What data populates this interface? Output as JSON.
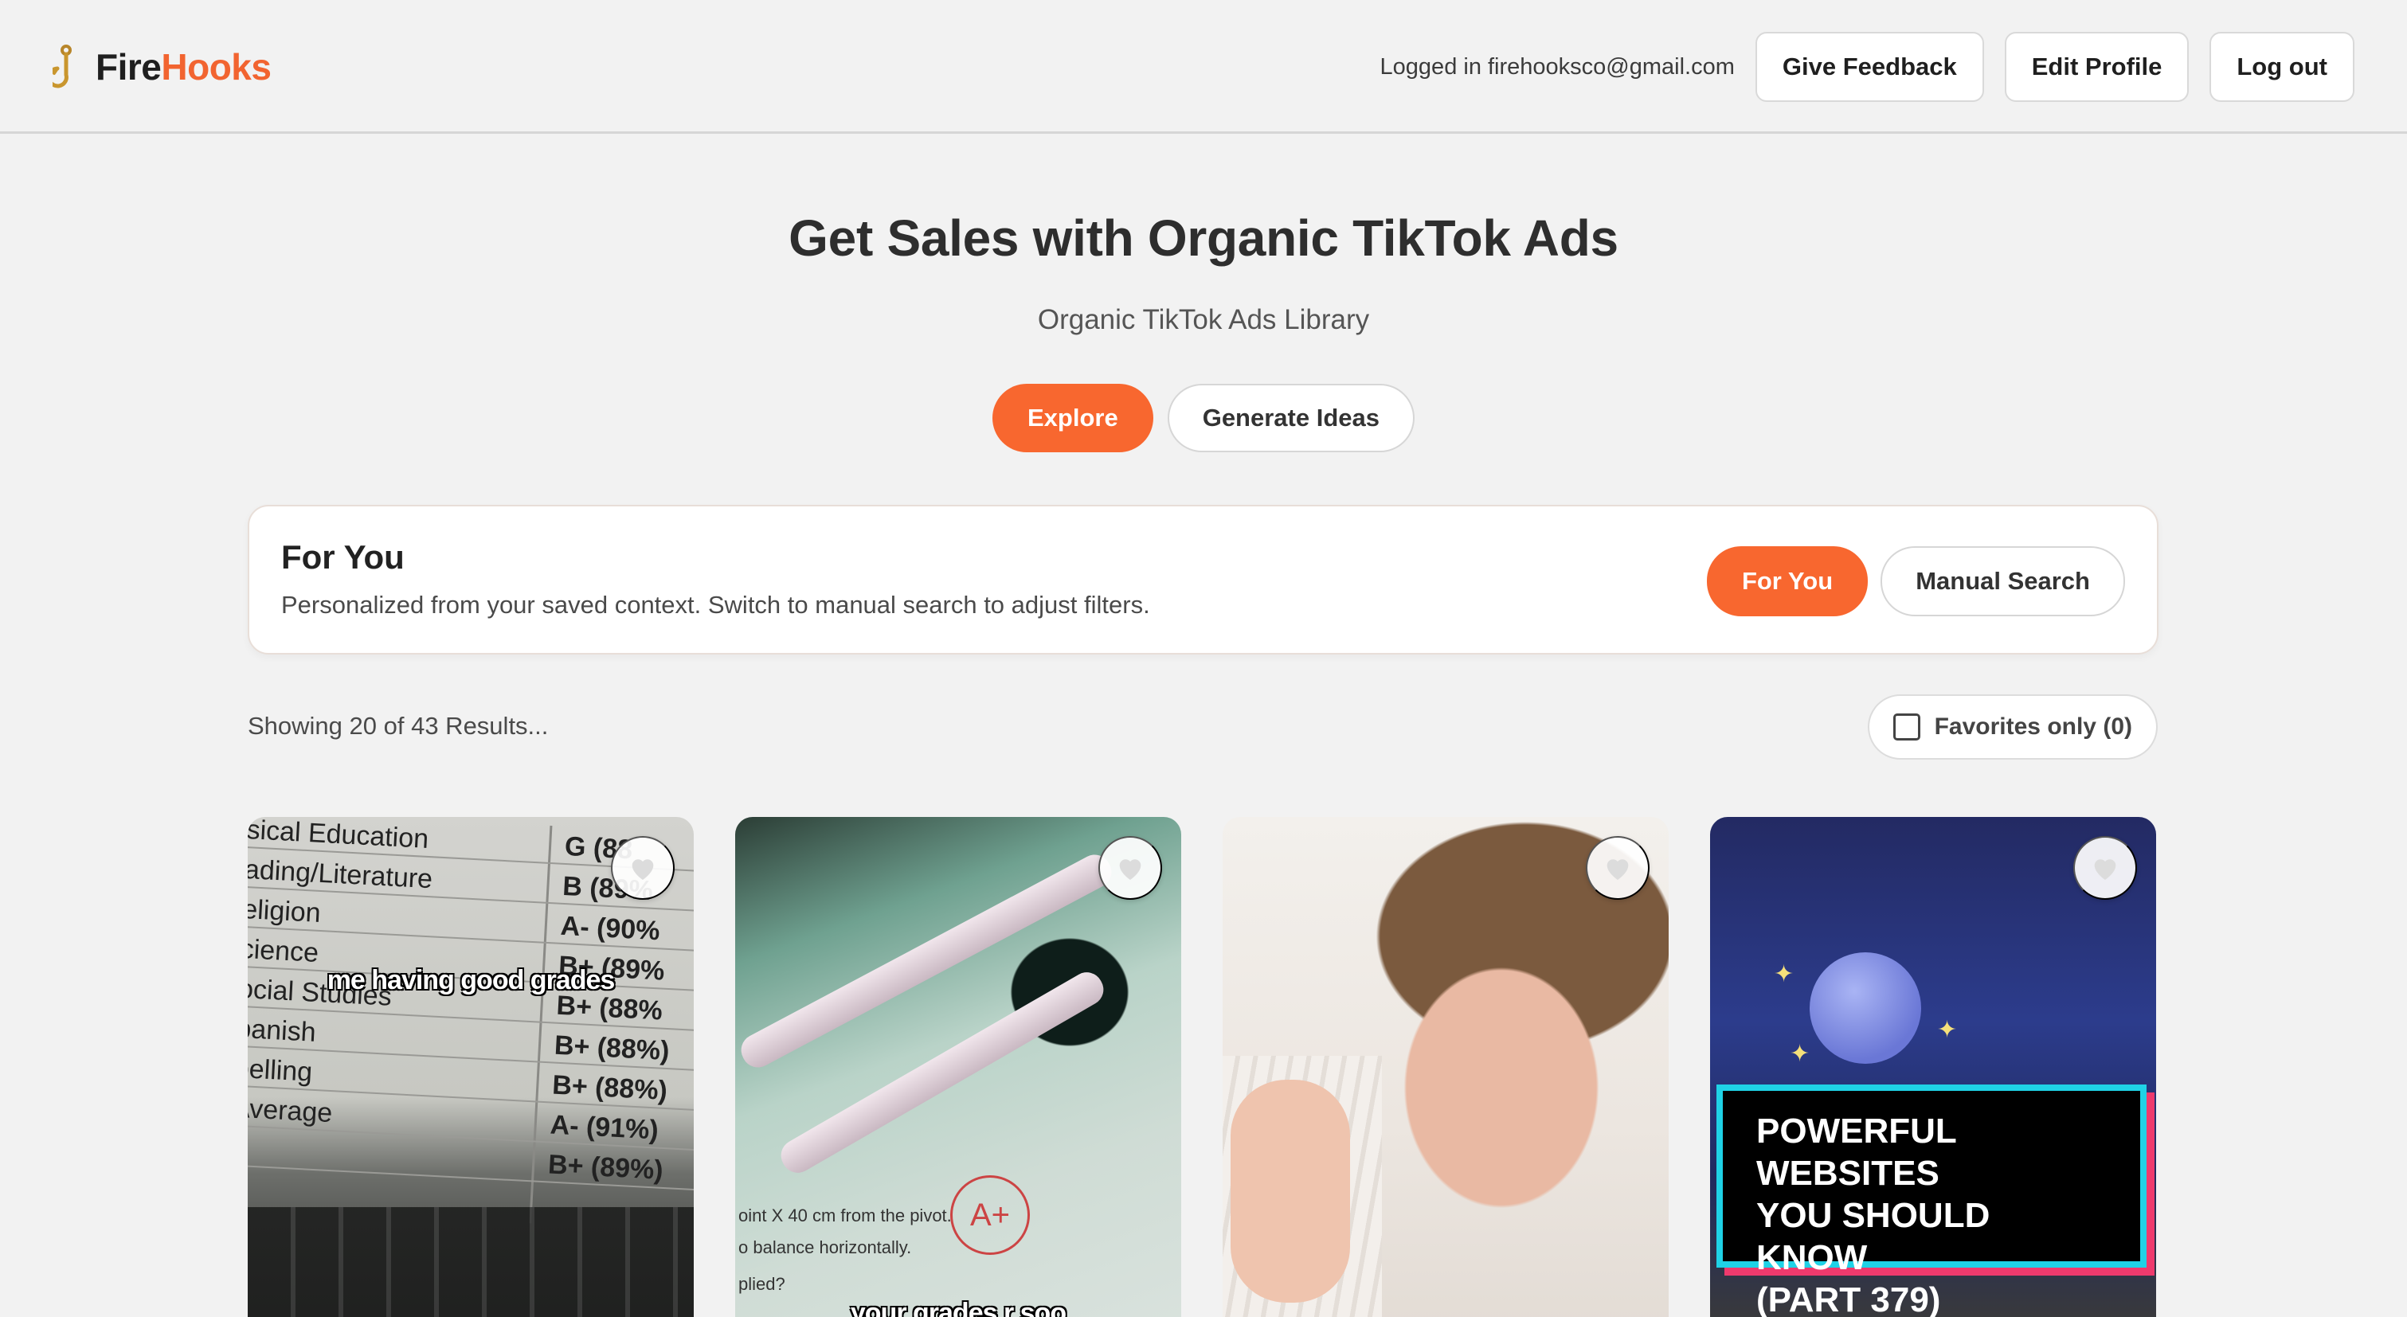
{
  "header": {
    "brand_fire": "Fire",
    "brand_hooks": "Hooks",
    "login_status": "Logged in firehooksco@gmail.com",
    "give_feedback_label": "Give Feedback",
    "edit_profile_label": "Edit Profile",
    "log_out_label": "Log out",
    "logo_icon": "fishhook-icon"
  },
  "hero": {
    "title": "Get Sales with Organic TikTok Ads",
    "subtitle": "Organic TikTok Ads Library",
    "tabs": [
      {
        "label": "Explore",
        "active": true
      },
      {
        "label": "Generate Ideas",
        "active": false
      }
    ]
  },
  "panel": {
    "title": "For You",
    "description": "Personalized from your saved context. Switch to manual search to adjust filters.",
    "tabs": [
      {
        "label": "For You",
        "active": true
      },
      {
        "label": "Manual Search",
        "active": false
      }
    ]
  },
  "results": {
    "summary": "Showing 20 of 43 Results...",
    "favorites_label": "Favorites only (0)",
    "favorites_checked": false
  },
  "cards": [
    {
      "caption": "me having good grades",
      "rows": [
        {
          "subject": "sical Education",
          "grade": "G (88"
        },
        {
          "subject": "ading/Literature",
          "grade": "B (89%"
        },
        {
          "subject": "eligion",
          "grade": "A- (90%"
        },
        {
          "subject": "cience",
          "grade": "B+ (89%"
        },
        {
          "subject": "ocial Studies",
          "grade": "B+ (88%"
        },
        {
          "subject": "panish",
          "grade": "B+ (88%)"
        },
        {
          "subject": "pelling",
          "grade": "B+ (88%)"
        },
        {
          "subject": "Average",
          "grade": "A- (91%)"
        },
        {
          "subject": "",
          "grade": "B+ (89%)"
        }
      ],
      "favorited": false
    },
    {
      "caption": "your grades r soo",
      "grade_mark": "A+",
      "notes": [
        "oint X 40 cm from the pivot.",
        "o balance horizontally.",
        "plied?"
      ],
      "favorited": false
    },
    {
      "caption": "",
      "favorited": false
    },
    {
      "caption": "POWERFUL WEBSITES YOU SHOULD KNOW (PART 379)",
      "banner_lines": [
        "POWERFUL WEBSITES",
        "YOU SHOULD KNOW",
        "(PART 379)"
      ],
      "favorited": false
    }
  ],
  "colors": {
    "accent": "#f8672f",
    "brand_accent": "#f26430",
    "page_bg": "#f2f2f2"
  }
}
